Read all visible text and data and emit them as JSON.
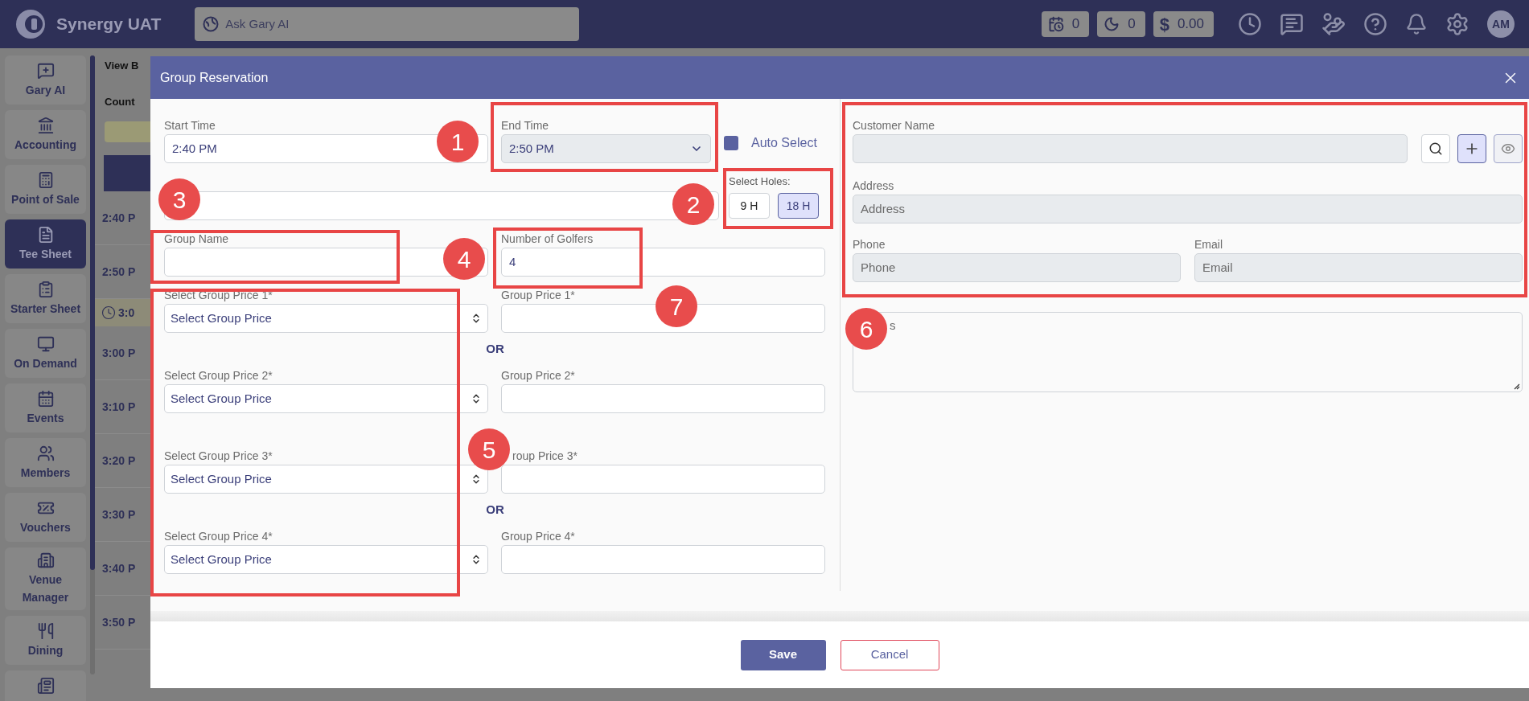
{
  "app": {
    "name": "Synergy UAT",
    "search_placeholder": "Ask Gary AI",
    "counters": [
      {
        "kind": "tee",
        "value": "0"
      },
      {
        "kind": "moon",
        "value": "0"
      },
      {
        "kind": "cash",
        "prefix": "$",
        "value": "0.00"
      }
    ],
    "avatar": "AM"
  },
  "sidebar": {
    "items": [
      {
        "label": "Gary AI",
        "selected": false
      },
      {
        "label": "Accounting",
        "selected": false
      },
      {
        "label": "Point of Sale",
        "selected": false
      },
      {
        "label": "Tee Sheet",
        "selected": true
      },
      {
        "label": "Starter Sheet",
        "selected": false
      },
      {
        "label": "On Demand",
        "selected": false
      },
      {
        "label": "Events",
        "selected": false
      },
      {
        "label": "Members",
        "selected": false
      },
      {
        "label": "Vouchers",
        "selected": false
      },
      {
        "label": "Venue Manager",
        "selected": false
      },
      {
        "label": "Dining",
        "selected": false
      }
    ]
  },
  "background": {
    "view_label": "View B",
    "count_label": "Count",
    "times": [
      {
        "text": "2:40 P",
        "kind": "slot"
      },
      {
        "text": "2:50 P",
        "kind": "slot"
      },
      {
        "text": "3:0",
        "kind": "now"
      },
      {
        "text": "3:00 P",
        "kind": "slot"
      },
      {
        "text": "3:10 P",
        "kind": "slot"
      },
      {
        "text": "3:20 P",
        "kind": "slot"
      },
      {
        "text": "3:30 P",
        "kind": "slot"
      },
      {
        "text": "3:40 P",
        "kind": "slot"
      },
      {
        "text": "3:50 P",
        "kind": "slot"
      }
    ]
  },
  "modal": {
    "title": "Group Reservation",
    "start_time": {
      "label": "Start Time",
      "value": "2:40 PM",
      "disabled": false
    },
    "end_time": {
      "label": "End Time",
      "value": "2:50 PM",
      "disabled": true
    },
    "auto_select": {
      "label": "Auto Select",
      "checked": true
    },
    "holes": {
      "label": "Select Holes:",
      "options": [
        {
          "label": "9 H",
          "selected": false
        },
        {
          "label": "18 H",
          "selected": true
        }
      ]
    },
    "group_name": {
      "label": "Group Name"
    },
    "golfers": {
      "label": "Number of Golfers",
      "value": "4"
    },
    "prices": [
      {
        "select_label": "Select Group Price 1*",
        "select_placeholder": "Select Group Price",
        "price_label": "Group Price 1*",
        "or_after": "OR"
      },
      {
        "select_label": "Select Group Price 2*",
        "select_placeholder": "Select Group Price",
        "price_label": "Group Price 2*"
      },
      {
        "select_label": "Select Group Price 3*",
        "select_placeholder": "Select Group Price",
        "price_label": "roup Price 3*",
        "or_after": "OR"
      },
      {
        "select_label": "Select Group Price 4*",
        "select_placeholder": "Select Group Price",
        "price_label": "Group Price 4*"
      }
    ],
    "customer": {
      "name_label": "Customer Name",
      "address_label": "Address",
      "address_placeholder": "Address",
      "phone_label": "Phone",
      "phone_placeholder": "Phone",
      "email_label": "Email",
      "email_placeholder": "Email",
      "disabled": true
    },
    "notes": {
      "placeholder": "s"
    },
    "buttons": [
      {
        "label": "Save",
        "kind": "primary"
      },
      {
        "label": "Cancel",
        "kind": "secondary"
      }
    ]
  },
  "annotations": [
    {
      "number": "1"
    },
    {
      "number": "2"
    },
    {
      "number": "3"
    },
    {
      "number": "4"
    },
    {
      "number": "5"
    },
    {
      "number": "6"
    },
    {
      "number": "7"
    }
  ]
}
